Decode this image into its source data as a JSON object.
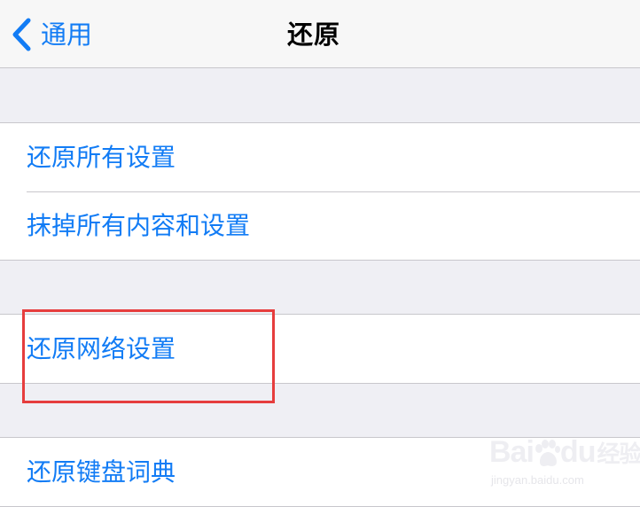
{
  "nav": {
    "back_label": "通用",
    "title": "还原"
  },
  "groups": [
    {
      "items": [
        "还原所有设置",
        "抹掉所有内容和设置"
      ]
    },
    {
      "items": [
        "还原网络设置"
      ]
    },
    {
      "items": [
        "还原键盘词典"
      ]
    }
  ],
  "highlight": {
    "color": "#e63d3d",
    "target": "还原网络设置"
  },
  "watermark": {
    "logo_text": "Bai",
    "logo_text_2": "du",
    "logo_text_3": "经验",
    "url": "jingyan.baidu.com"
  },
  "colors": {
    "accent": "#127cf5",
    "background": "#efeff4",
    "cell_background": "#ffffff",
    "separator": "#c8c7cc"
  },
  "icons": {
    "back": "chevron-left-icon",
    "watermark_paw": "paw-icon"
  }
}
